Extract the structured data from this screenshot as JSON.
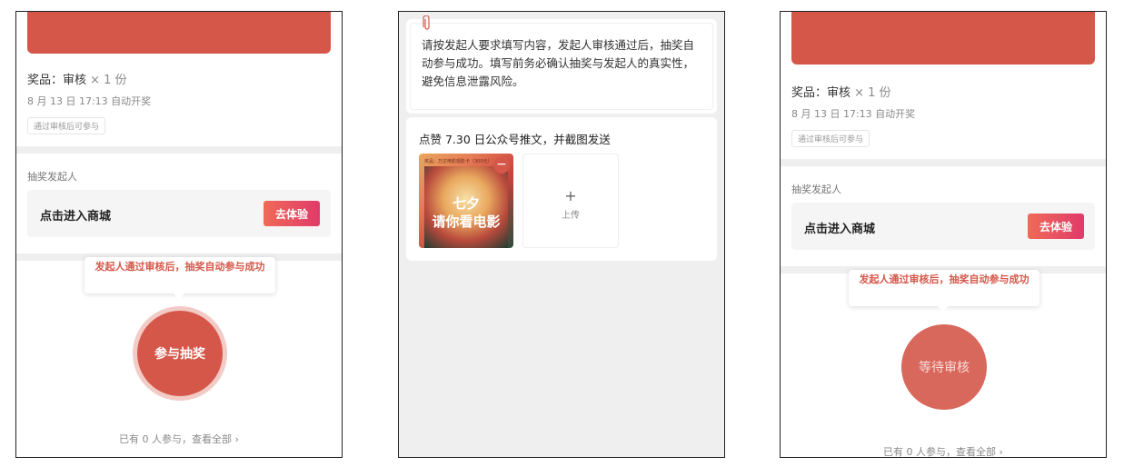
{
  "screens": [
    {
      "prize_label": "奖品：审核",
      "prize_qty": "× 1 份",
      "draw_time": "8 月 13 日 17:13 自动开奖",
      "tag": "通过审核后可参与",
      "organizer_title": "抽奖发起人",
      "mall_label": "点击进入商城",
      "mall_button": "去体验",
      "tooltip": "发起人通过审核后，抽奖自动参与成功",
      "action_button": "参与抽奖",
      "participants": "已有 0 人参与，查看全部 ›"
    },
    {
      "notice": "请按发起人要求填写内容，发起人审核通过后，抽奖自动参与成功。填写前务必确认抽奖与发起人的真实性，避免信息泄露风险。",
      "task_title": "点赞 7.30 日公众号推文，并截图发送",
      "thumb_top": "奖品：万达电影观影卡（300元）",
      "thumb_line1": "七夕",
      "thumb_line2": "请你看电影",
      "delete_symbol": "−",
      "upload_plus": "+",
      "upload_label": "上传"
    },
    {
      "prize_label": "奖品：审核",
      "prize_qty": "× 1 份",
      "draw_time": "8 月 13 日 17:13 自动开奖",
      "tag": "通过审核后可参与",
      "organizer_title": "抽奖发起人",
      "mall_label": "点击进入商城",
      "mall_button": "去体验",
      "tooltip": "发起人通过审核后，抽奖自动参与成功",
      "action_button": "等待审核",
      "participants": "已有 0 人参与，查看全部 ›"
    }
  ],
  "colors": {
    "accent": "#d5574a",
    "button_gradient_start": "#f06a58",
    "button_gradient_end": "#e03a6a"
  },
  "icons": [
    "paperclip-icon",
    "delete-icon",
    "plus-icon",
    "chevron-right-icon"
  ]
}
